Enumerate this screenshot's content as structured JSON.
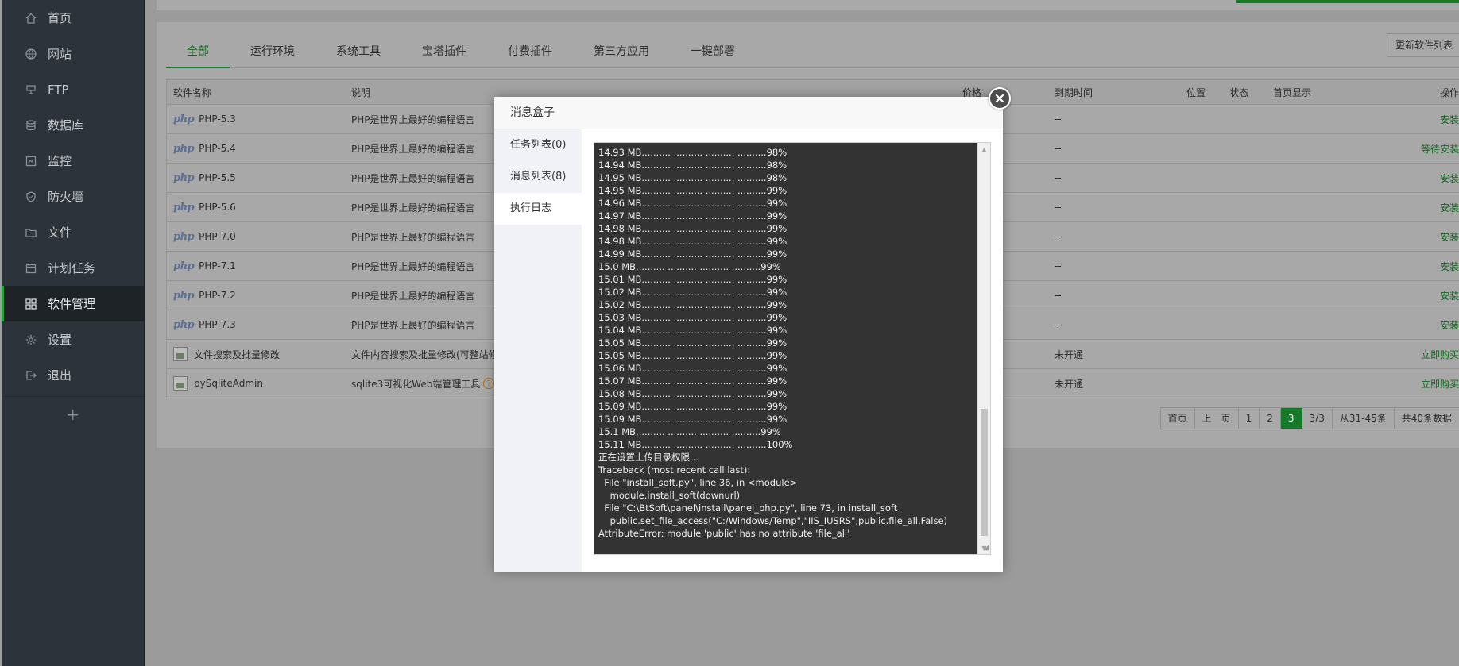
{
  "sidebar": {
    "items": [
      {
        "label": "首页",
        "icon": "home-icon"
      },
      {
        "label": "网站",
        "icon": "globe-icon"
      },
      {
        "label": "FTP",
        "icon": "ftp-icon"
      },
      {
        "label": "数据库",
        "icon": "database-icon"
      },
      {
        "label": "监控",
        "icon": "monitor-icon"
      },
      {
        "label": "防火墙",
        "icon": "shield-icon"
      },
      {
        "label": "文件",
        "icon": "folder-icon"
      },
      {
        "label": "计划任务",
        "icon": "calendar-icon"
      },
      {
        "label": "软件管理",
        "icon": "grid-icon",
        "active": true
      },
      {
        "label": "设置",
        "icon": "gear-icon"
      },
      {
        "label": "退出",
        "icon": "logout-icon"
      }
    ],
    "add_label": "+"
  },
  "tabs": [
    "全部",
    "运行环境",
    "系统工具",
    "宝塔插件",
    "付费插件",
    "第三方应用",
    "一键部署"
  ],
  "update_button": "更新软件列表",
  "table": {
    "headers": {
      "name": "软件名称",
      "desc": "说明",
      "price": "价格",
      "expire": "到期时间",
      "position": "位置",
      "status": "状态",
      "home": "首页显示",
      "op": "操作"
    },
    "rows": [
      {
        "logo": "php",
        "name": "PHP-5.3",
        "desc": "PHP是世界上最好的编程语言",
        "expire": "--",
        "op": "安装"
      },
      {
        "logo": "php",
        "name": "PHP-5.4",
        "desc": "PHP是世界上最好的编程语言",
        "expire": "--",
        "op": "等待安装"
      },
      {
        "logo": "php",
        "name": "PHP-5.5",
        "desc": "PHP是世界上最好的编程语言",
        "expire": "--",
        "op": "安装"
      },
      {
        "logo": "php",
        "name": "PHP-5.6",
        "desc": "PHP是世界上最好的编程语言",
        "expire": "--",
        "op": "安装"
      },
      {
        "logo": "php",
        "name": "PHP-7.0",
        "desc": "PHP是世界上最好的编程语言",
        "expire": "--",
        "op": "安装"
      },
      {
        "logo": "php",
        "name": "PHP-7.1",
        "desc": "PHP是世界上最好的编程语言",
        "expire": "--",
        "op": "安装"
      },
      {
        "logo": "php",
        "name": "PHP-7.2",
        "desc": "PHP是世界上最好的编程语言",
        "expire": "--",
        "op": "安装"
      },
      {
        "logo": "php",
        "name": "PHP-7.3",
        "desc": "PHP是世界上最好的编程语言",
        "expire": "--",
        "op": "安装"
      },
      {
        "logo": "img",
        "name": "文件搜索及批量修改",
        "desc": "文件内容搜索及批量修改(可整站修",
        "expire": "未开通",
        "op": "立即购买"
      },
      {
        "logo": "img",
        "name": "pySqliteAdmin",
        "desc": "sqlite3可视化Web端管理工具",
        "expire": "未开通",
        "op": "立即购买",
        "help": "?"
      }
    ]
  },
  "pager": [
    "首页",
    "上一页",
    "1",
    "2",
    "3",
    "3/3",
    "从31-45条",
    "共40条数据"
  ],
  "pager_current": "3",
  "modal": {
    "title": "消息盒子",
    "tabs": [
      {
        "label": "任务列表(0)"
      },
      {
        "label": "消息列表(8)"
      },
      {
        "label": "执行日志",
        "active": true
      }
    ],
    "log_lines": [
      "14.93 MB.......... .......... .......... ..........98%",
      "14.94 MB.......... .......... .......... ..........98%",
      "14.95 MB.......... .......... .......... ..........98%",
      "14.95 MB.......... .......... .......... ..........99%",
      "14.96 MB.......... .......... .......... ..........99%",
      "14.97 MB.......... .......... .......... ..........99%",
      "14.98 MB.......... .......... .......... ..........99%",
      "14.98 MB.......... .......... .......... ..........99%",
      "14.99 MB.......... .......... .......... ..........99%",
      "15.0 MB.......... .......... .......... ..........99%",
      "15.01 MB.......... .......... .......... ..........99%",
      "15.02 MB.......... .......... .......... ..........99%",
      "15.02 MB.......... .......... .......... ..........99%",
      "15.03 MB.......... .......... .......... ..........99%",
      "15.04 MB.......... .......... .......... ..........99%",
      "15.05 MB.......... .......... .......... ..........99%",
      "15.05 MB.......... .......... .......... ..........99%",
      "15.06 MB.......... .......... .......... ..........99%",
      "15.07 MB.......... .......... .......... ..........99%",
      "15.08 MB.......... .......... .......... ..........99%",
      "15.09 MB.......... .......... .......... ..........99%",
      "15.09 MB.......... .......... .......... ..........99%",
      "15.1 MB.......... .......... .......... ..........99%",
      "15.11 MB.......... .......... .......... ..........100%",
      "正在设置上传目录权限...",
      "Traceback (most recent call last):",
      "  File \"install_soft.py\", line 36, in <module>",
      "    module.install_soft(downurl)",
      "  File \"C:\\BtSoft\\panel\\install\\panel_php.py\", line 73, in install_soft",
      "    public.set_file_access(\"C:/Windows/Temp\",\"IIS_IUSRS\",public.file_all,False)",
      "AttributeError: module 'public' has no attribute 'file_all'"
    ]
  },
  "colors": {
    "accent": "#20a53a",
    "sidebar_bg": "#2c333a",
    "log_bg": "#333333"
  }
}
